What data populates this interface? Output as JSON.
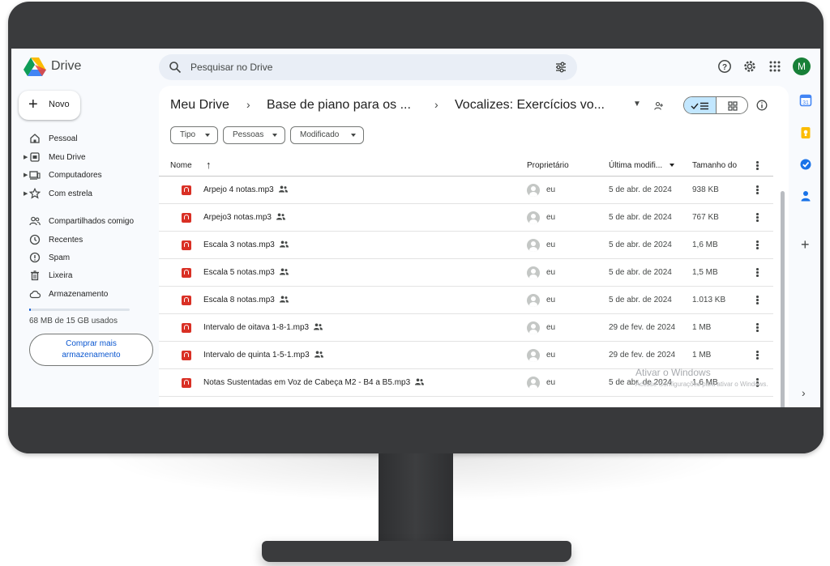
{
  "app": {
    "name": "Drive"
  },
  "search": {
    "placeholder": "Pesquisar no Drive"
  },
  "user": {
    "initial": "M",
    "avatar_color": "#188038"
  },
  "new_button": {
    "label": "Novo"
  },
  "sidebar": {
    "items": [
      {
        "label": "Pessoal",
        "icon": "home-icon",
        "expandable": false
      },
      {
        "label": "Meu Drive",
        "icon": "drive-icon",
        "expandable": true
      },
      {
        "label": "Computadores",
        "icon": "computer-icon",
        "expandable": true
      },
      {
        "label": "Com estrela",
        "icon": "star-icon",
        "expandable": true
      },
      {
        "label": "Compartilhados comigo",
        "icon": "shared-icon",
        "expandable": false
      },
      {
        "label": "Recentes",
        "icon": "clock-icon",
        "expandable": false
      },
      {
        "label": "Spam",
        "icon": "spam-icon",
        "expandable": false
      },
      {
        "label": "Lixeira",
        "icon": "trash-icon",
        "expandable": false
      },
      {
        "label": "Armazenamento",
        "icon": "cloud-icon",
        "expandable": false
      }
    ],
    "storage": {
      "used_text": "68 MB de 15 GB usados",
      "used_fraction": 0.005
    },
    "buy_storage": {
      "line1": "Comprar mais",
      "line2": "armazenamento"
    }
  },
  "breadcrumb": [
    "Meu Drive",
    "Base de piano para os ...",
    "Vocalizes: Exercícios vo..."
  ],
  "filters": [
    "Tipo",
    "Pessoas",
    "Modificado"
  ],
  "table": {
    "headers": {
      "name": "Nome",
      "owner": "Proprietário",
      "modified": "Última modifi...",
      "size": "Tamanho do"
    },
    "rows": [
      {
        "name": "Arpejo 4 notas.mp3",
        "owner": "eu",
        "modified": "5 de abr. de 2024",
        "size": "938 KB"
      },
      {
        "name": "Arpejo3 notas.mp3",
        "owner": "eu",
        "modified": "5 de abr. de 2024",
        "size": "767 KB"
      },
      {
        "name": "Escala 3 notas.mp3",
        "owner": "eu",
        "modified": "5 de abr. de 2024",
        "size": "1,6 MB"
      },
      {
        "name": "Escala 5 notas.mp3",
        "owner": "eu",
        "modified": "5 de abr. de 2024",
        "size": "1,5 MB"
      },
      {
        "name": "Escala 8 notas.mp3",
        "owner": "eu",
        "modified": "5 de abr. de 2024",
        "size": "1.013 KB"
      },
      {
        "name": "Intervalo de oitava 1-8-1.mp3",
        "owner": "eu",
        "modified": "29 de fev. de 2024",
        "size": "1 MB"
      },
      {
        "name": "Intervalo de quinta 1-5-1.mp3",
        "owner": "eu",
        "modified": "29 de fev. de 2024",
        "size": "1 MB"
      },
      {
        "name": "Notas Sustentadas em Voz de Cabeça M2 - B4 a B5.mp3",
        "owner": "eu",
        "modified": "5 de abr. de 2024",
        "size": "1,6 MB"
      }
    ]
  },
  "watermark": {
    "title": "Ativar o Windows",
    "subtitle": "Acesse Configurações para ativar o Windows."
  },
  "colors": {
    "accent": "#0b57d0",
    "selected_toggle": "#c2e7ff",
    "file_icon": "#d93025"
  }
}
